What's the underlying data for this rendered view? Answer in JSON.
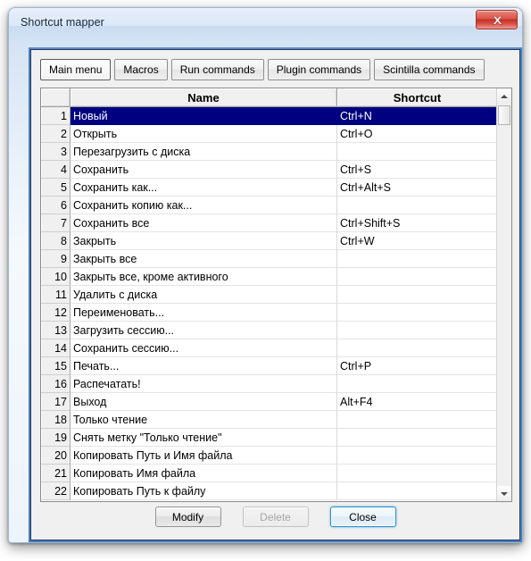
{
  "window": {
    "title": "Shortcut mapper",
    "close_icon": "close-x-icon"
  },
  "tabs": [
    {
      "label": "Main menu",
      "active": true
    },
    {
      "label": "Macros",
      "active": false
    },
    {
      "label": "Run commands",
      "active": false
    },
    {
      "label": "Plugin commands",
      "active": false
    },
    {
      "label": "Scintilla commands",
      "active": false
    }
  ],
  "list": {
    "headers": {
      "index": "",
      "name": "Name",
      "shortcut": "Shortcut"
    },
    "selected_index": 1,
    "rows": [
      {
        "index": "1",
        "name": "Новый",
        "shortcut": "Ctrl+N"
      },
      {
        "index": "2",
        "name": "Открыть",
        "shortcut": "Ctrl+O"
      },
      {
        "index": "3",
        "name": "Перезагрузить с диска",
        "shortcut": ""
      },
      {
        "index": "4",
        "name": "Сохранить",
        "shortcut": "Ctrl+S"
      },
      {
        "index": "5",
        "name": "Сохранить как...",
        "shortcut": "Ctrl+Alt+S"
      },
      {
        "index": "6",
        "name": "Сохранить копию как...",
        "shortcut": ""
      },
      {
        "index": "7",
        "name": "Сохранить все",
        "shortcut": "Ctrl+Shift+S"
      },
      {
        "index": "8",
        "name": "Закрыть",
        "shortcut": "Ctrl+W"
      },
      {
        "index": "9",
        "name": "Закрыть все",
        "shortcut": ""
      },
      {
        "index": "10",
        "name": "Закрыть все, кроме активного",
        "shortcut": ""
      },
      {
        "index": "11",
        "name": "Удалить с диска",
        "shortcut": ""
      },
      {
        "index": "12",
        "name": "Переименовать...",
        "shortcut": ""
      },
      {
        "index": "13",
        "name": "Загрузить сессию...",
        "shortcut": ""
      },
      {
        "index": "14",
        "name": "Сохранить сессию...",
        "shortcut": ""
      },
      {
        "index": "15",
        "name": "Печать...",
        "shortcut": "Ctrl+P"
      },
      {
        "index": "16",
        "name": "Распечатать!",
        "shortcut": ""
      },
      {
        "index": "17",
        "name": "Выход",
        "shortcut": "Alt+F4"
      },
      {
        "index": "18",
        "name": "Только чтение",
        "shortcut": ""
      },
      {
        "index": "19",
        "name": "Снять метку \"Только чтение\"",
        "shortcut": ""
      },
      {
        "index": "20",
        "name": "Копировать Путь и Имя файла",
        "shortcut": ""
      },
      {
        "index": "21",
        "name": "Копировать Имя файла",
        "shortcut": ""
      },
      {
        "index": "22",
        "name": "Копировать Путь к файлу",
        "shortcut": ""
      }
    ]
  },
  "scrollbar": {
    "up_icon": "scroll-up-arrow-icon",
    "down_icon": "scroll-down-arrow-icon"
  },
  "buttons": {
    "modify": "Modify",
    "delete": "Delete",
    "close": "Close"
  },
  "colors": {
    "selection": "#000080",
    "window_border": "#4a7ebb",
    "close_button": "#c32e24",
    "default_button_focus": "#2a8fd0",
    "dialog_face": "#f0f0f0"
  }
}
